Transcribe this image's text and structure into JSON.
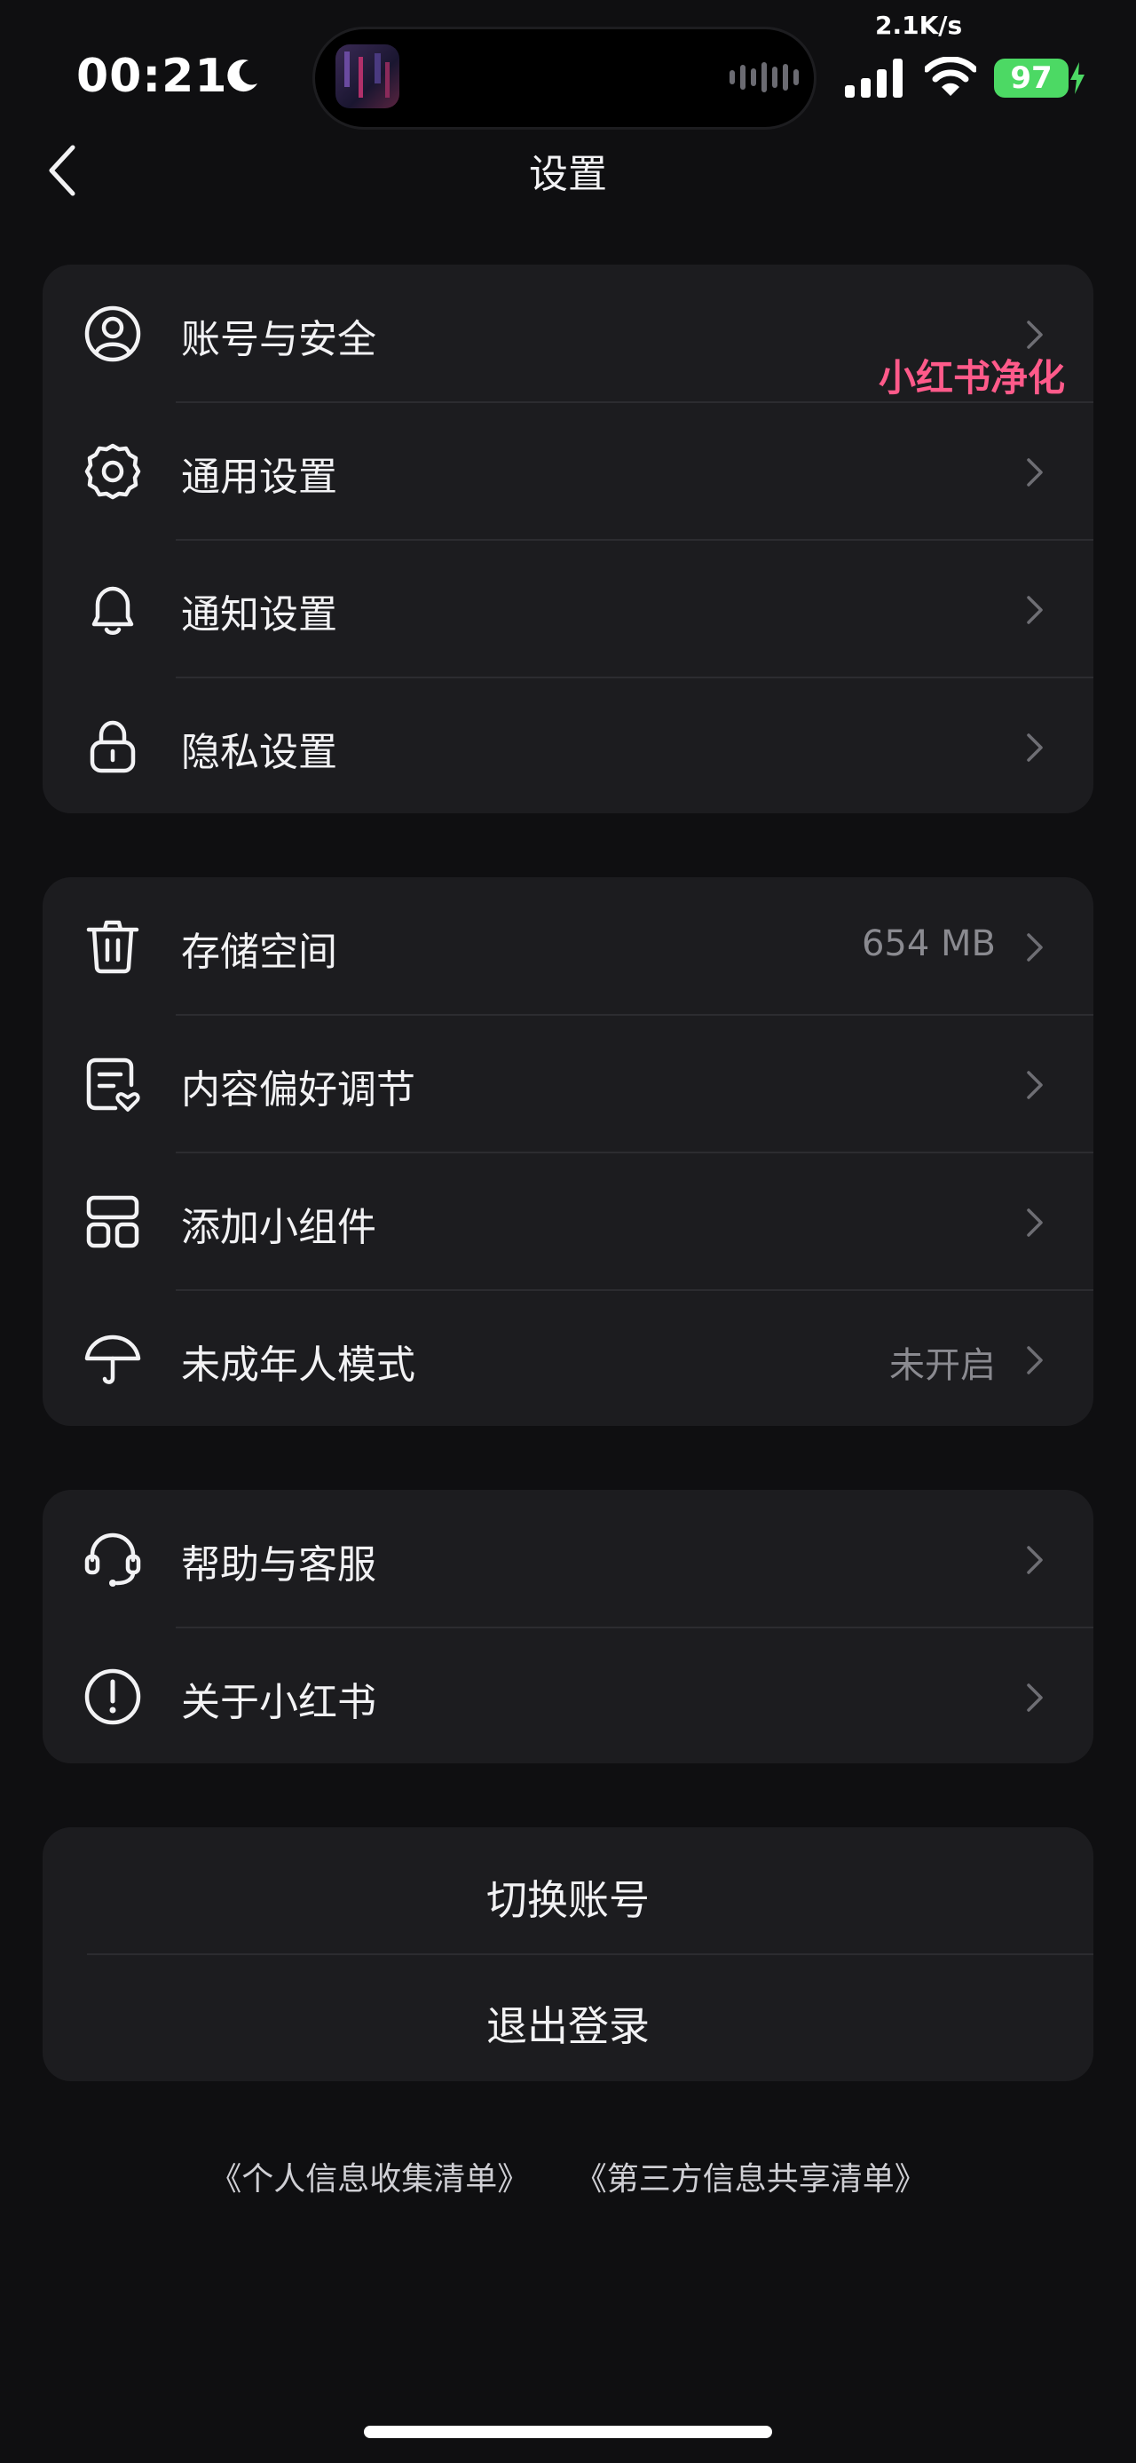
{
  "status_bar": {
    "time": "00:21",
    "net_speed": "2.1K/s",
    "battery": "97"
  },
  "nav": {
    "back_icon": "chevron-left-icon",
    "title": "设置"
  },
  "watermark": "小红书净化",
  "groups": [
    {
      "items": [
        {
          "icon": "user-circle-icon",
          "label": "账号与安全",
          "value": ""
        },
        {
          "icon": "gear-icon",
          "label": "通用设置",
          "value": ""
        },
        {
          "icon": "bell-icon",
          "label": "通知设置",
          "value": ""
        },
        {
          "icon": "lock-icon",
          "label": "隐私设置",
          "value": ""
        }
      ]
    },
    {
      "items": [
        {
          "icon": "trash-icon",
          "label": "存储空间",
          "value": "654 MB"
        },
        {
          "icon": "note-heart-icon",
          "label": "内容偏好调节",
          "value": ""
        },
        {
          "icon": "widget-icon",
          "label": "添加小组件",
          "value": ""
        },
        {
          "icon": "umbrella-icon",
          "label": "未成年人模式",
          "value": "未开启"
        }
      ]
    },
    {
      "items": [
        {
          "icon": "headset-icon",
          "label": "帮助与客服",
          "value": ""
        },
        {
          "icon": "info-icon",
          "label": "关于小红书",
          "value": ""
        }
      ]
    }
  ],
  "account_actions": {
    "switch_label": "切换账号",
    "logout_label": "退出登录"
  },
  "footer_links": {
    "personal_info": "《个人信息收集清单》",
    "third_party": "《第三方信息共享清单》"
  },
  "colors": {
    "background": "#0f0f11",
    "card": "#1c1c1f",
    "watermark": "#ff5a8a",
    "battery": "#4cd964"
  }
}
